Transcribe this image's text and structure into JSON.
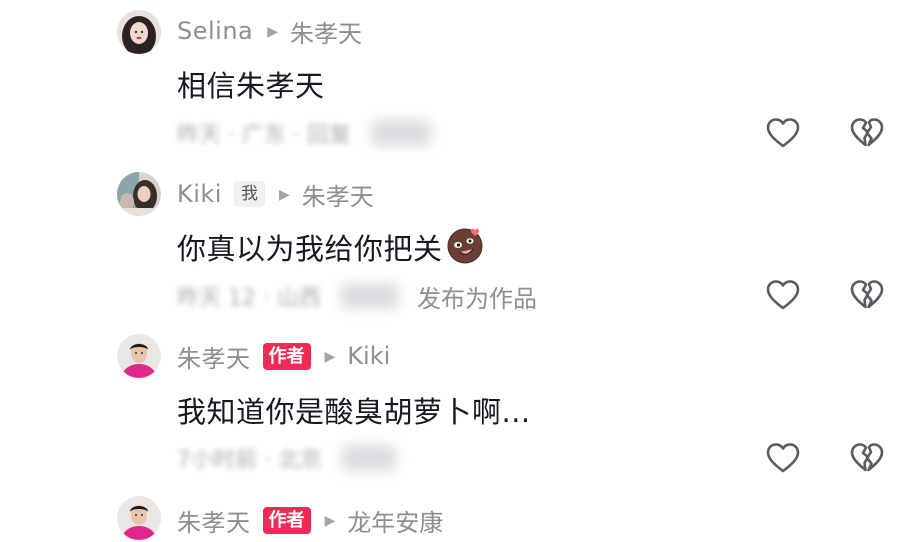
{
  "comments": [
    {
      "username": "Selina",
      "reply_to": "朱孝天",
      "text": "相信朱孝天",
      "info_blurred": "昨天 · 广东 · 回复"
    },
    {
      "username": "Kiki",
      "badge": "我",
      "reply_to": "朱孝天",
      "text": "你真以为我给你把关",
      "info_blurred": "昨天 12 · 山西",
      "extra_action": "发布为作品"
    },
    {
      "username": "朱孝天",
      "badge": "作者",
      "reply_to": "Kiki",
      "text": "我知道你是酸臭胡萝卜啊...",
      "info_blurred": "7小时前 · 北京"
    },
    {
      "username": "朱孝天",
      "badge": "作者",
      "reply_to": "龙年安康"
    }
  ],
  "icons": {
    "like": "heart-outline-icon",
    "dislike": "broken-heart-icon",
    "reply_arrow": "play-triangle-icon"
  },
  "colors": {
    "author_badge": "#ee2a56",
    "meta_gray": "#8e8e93",
    "text": "#161823"
  }
}
